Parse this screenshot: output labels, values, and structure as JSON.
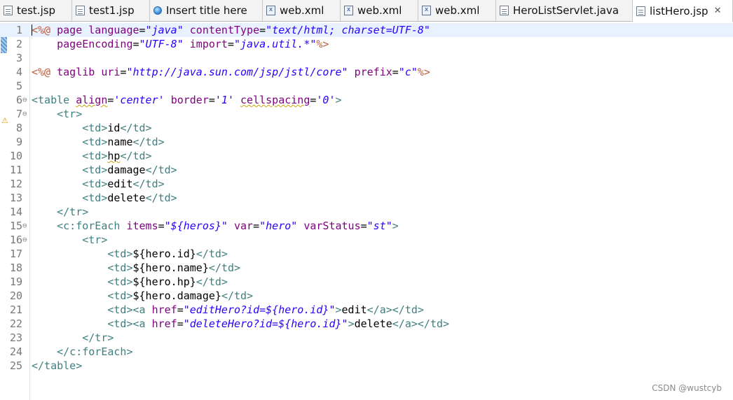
{
  "tabs": [
    {
      "label": "test.jsp",
      "icon": "jsp-file-icon"
    },
    {
      "label": "test1.jsp",
      "icon": "jsp-file-icon"
    },
    {
      "label": "Insert title here",
      "icon": "globe-icon"
    },
    {
      "label": "web.xml",
      "icon": "xml-file-icon"
    },
    {
      "label": "web.xml",
      "icon": "xml-file-icon"
    },
    {
      "label": "web.xml",
      "icon": "xml-file-icon"
    },
    {
      "label": "HeroListServlet.java",
      "icon": "java-file-icon"
    },
    {
      "label": "listHero.jsp",
      "icon": "jsp-file-icon",
      "active": true,
      "close": "✕"
    }
  ],
  "line_numbers": [
    "1",
    "2",
    "3",
    "4",
    "5",
    "6",
    "7",
    "8",
    "9",
    "10",
    "11",
    "12",
    "13",
    "14",
    "15",
    "16",
    "17",
    "18",
    "19",
    "20",
    "21",
    "22",
    "23",
    "24",
    "25"
  ],
  "code": {
    "l1_a": "<%@",
    "l1_b": "page",
    "l1_c": "language",
    "l1_d": "\"java\"",
    "l1_e": "contentType",
    "l1_f": "\"text/html; charset=UTF-8\"",
    "l2_a": "pageEncoding",
    "l2_b": "\"UTF-8\"",
    "l2_c": "import",
    "l2_d": "\"java.util.*\"",
    "l2_e": "%>",
    "l4_a": "<%@",
    "l4_b": "taglib",
    "l4_c": "uri",
    "l4_d": "\"http://java.sun.com/jsp/jstl/core\"",
    "l4_e": "prefix",
    "l4_f": "\"c\"",
    "l4_g": "%>",
    "l6_a": "<table",
    "l6_b": "align",
    "l6_c": "'center'",
    "l6_d": "border",
    "l6_e": "'1'",
    "l6_f": "cellspacing",
    "l6_g": "'0'",
    "l6_h": ">",
    "tr_open": "<tr>",
    "tr_close": "</tr>",
    "td_open": "<td>",
    "td_close": "</td>",
    "l8": "id",
    "l9": "name",
    "l10": "hp",
    "l11": "damage",
    "l12": "edit",
    "l13": "delete",
    "l15_a": "<c:forEach",
    "l15_b": "items",
    "l15_c": "\"${heros}\"",
    "l15_d": "var",
    "l15_e": "\"hero\"",
    "l15_f": "varStatus",
    "l15_g": "\"st\"",
    "l15_h": ">",
    "l17": "${hero.id}",
    "l18": "${hero.name}",
    "l19": "${hero.hp}",
    "l20": "${hero.damage}",
    "a_open": "<a",
    "href": "href",
    "l21_href": "\"editHero?id=${hero.id}\"",
    "l21_text": "edit",
    "a_close": "</a>",
    "l22_href": "\"deleteHero?id=${hero.id}\"",
    "l22_text": "delete",
    "l24": "</c:forEach>",
    "l25": "</table>"
  },
  "watermark": "CSDN @wustcyb"
}
